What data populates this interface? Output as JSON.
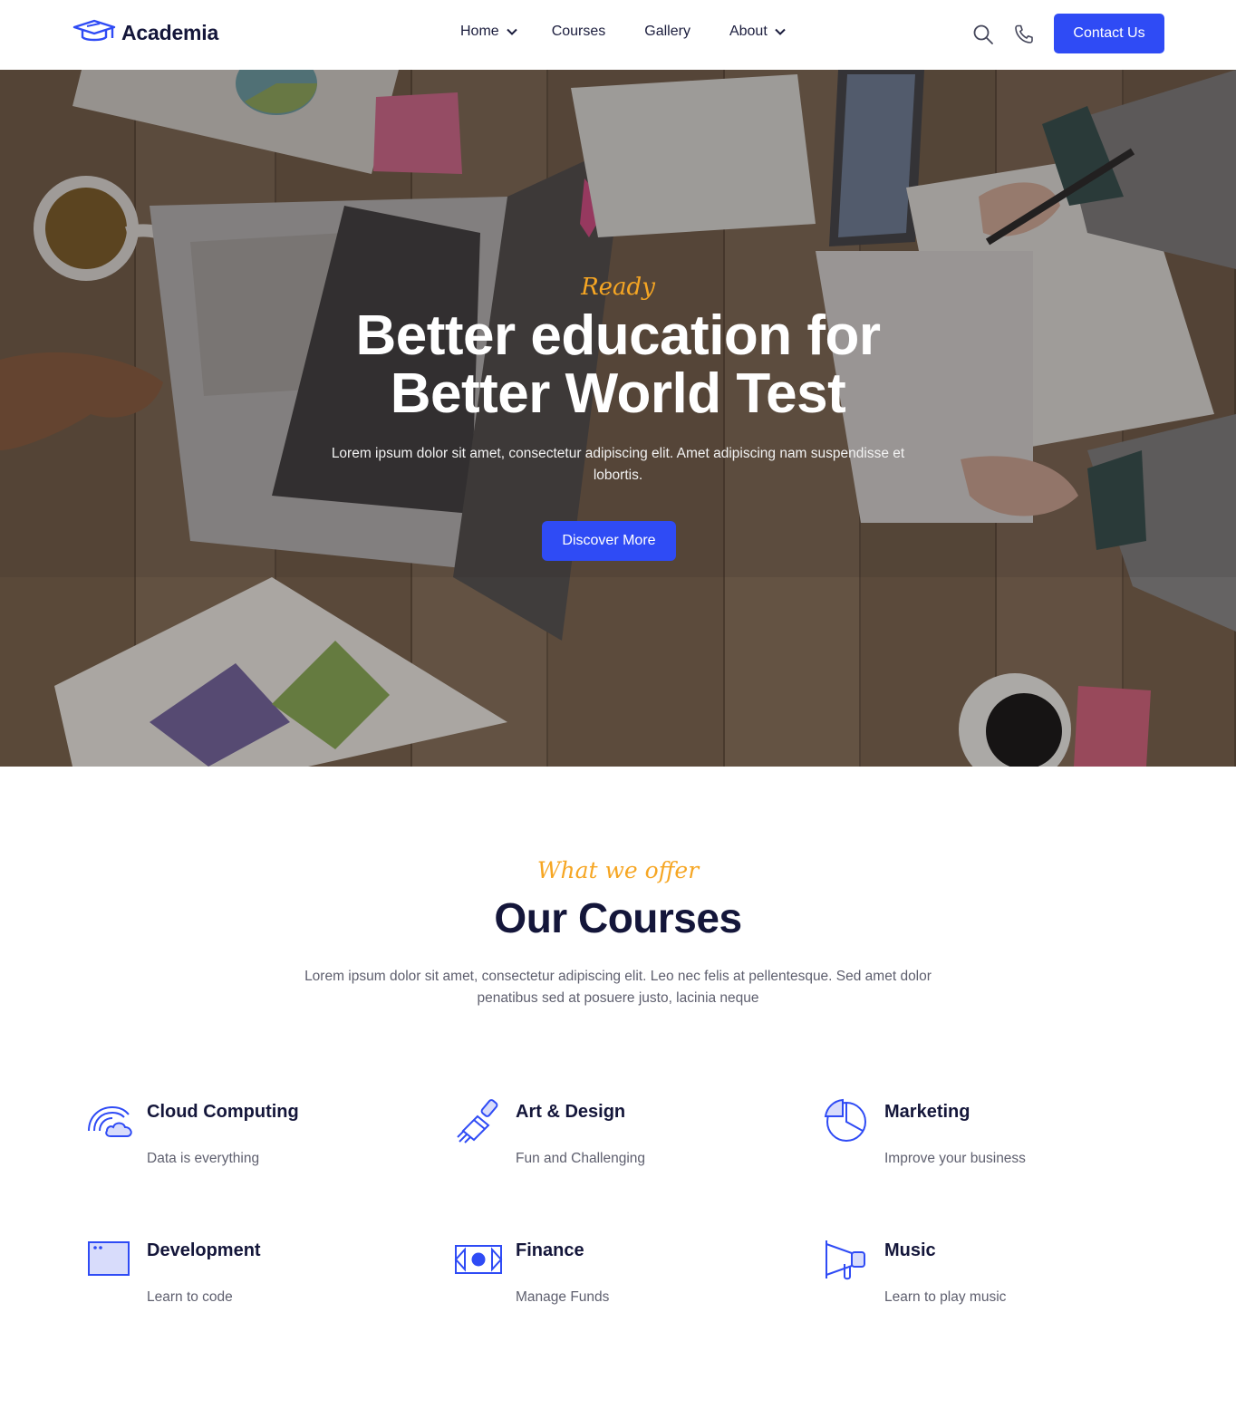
{
  "header": {
    "logo_text": "Academia",
    "nav": [
      {
        "label": "Home",
        "has_dropdown": true
      },
      {
        "label": "Courses",
        "has_dropdown": false
      },
      {
        "label": "Gallery",
        "has_dropdown": false
      },
      {
        "label": "About",
        "has_dropdown": true
      }
    ],
    "icons": [
      "search-icon",
      "phone-icon"
    ],
    "contact_label": "Contact Us"
  },
  "hero": {
    "eyebrow": "Ready",
    "title_line1": "Better education for",
    "title_line2": "Better World Test",
    "description": "Lorem ipsum dolor sit amet, consectetur adipiscing elit. Amet adipiscing nam suspendisse et lobortis.",
    "cta_label": "Discover More"
  },
  "offer": {
    "eyebrow": "What we offer",
    "title": "Our Courses",
    "description": "Lorem ipsum dolor sit amet, consectetur adipiscing elit. Leo nec felis at pellentesque. Sed amet dolor penatibus sed at posuere justo, lacinia neque",
    "courses": [
      {
        "title": "Cloud Computing",
        "subtitle": "Data is everything",
        "icon": "cloud-icon"
      },
      {
        "title": "Art & Design",
        "subtitle": "Fun and Challenging",
        "icon": "paintbrush-icon"
      },
      {
        "title": "Marketing",
        "subtitle": "Improve your business",
        "icon": "pie-chart-icon"
      },
      {
        "title": "Development",
        "subtitle": "Learn to code",
        "icon": "browser-window-icon"
      },
      {
        "title": "Finance",
        "subtitle": "Manage Funds",
        "icon": "money-icon"
      },
      {
        "title": "Music",
        "subtitle": "Learn to play music",
        "icon": "megaphone-icon"
      }
    ]
  },
  "colors": {
    "accent": "#2f4bf5",
    "eyebrow": "#f6a623",
    "heading": "#14163a",
    "body_text": "#5e5f6e"
  }
}
